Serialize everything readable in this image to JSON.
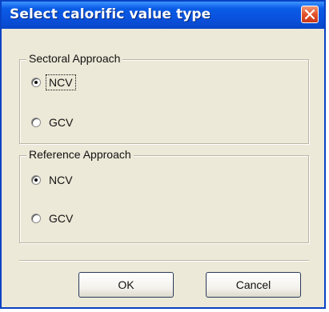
{
  "dialog": {
    "title": "Select calorific value type",
    "close_icon": "close-icon"
  },
  "sectoral": {
    "legend": "Sectoral Approach",
    "options": [
      {
        "label": "NCV",
        "checked": true,
        "focused": true
      },
      {
        "label": "GCV",
        "checked": false,
        "focused": false
      }
    ]
  },
  "reference": {
    "legend": "Reference Approach",
    "options": [
      {
        "label": "NCV",
        "checked": true,
        "focused": false
      },
      {
        "label": "GCV",
        "checked": false,
        "focused": false
      }
    ]
  },
  "buttons": {
    "ok_label": "OK",
    "cancel_label": "Cancel"
  },
  "colors": {
    "titlebar": "#0a52de",
    "close": "#e2512a",
    "face": "#ece9d8"
  }
}
